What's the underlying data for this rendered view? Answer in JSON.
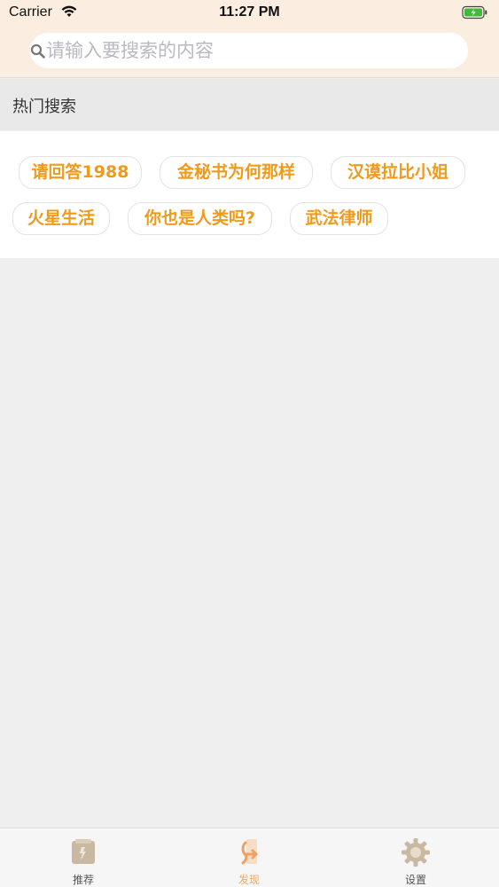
{
  "status_bar": {
    "carrier": "Carrier",
    "time": "11:27 PM"
  },
  "search": {
    "placeholder": "请输入要搜索的内容",
    "value": ""
  },
  "hot_search": {
    "title": "热门搜索",
    "tags": [
      "请回答1988",
      "金秘书为何那样",
      "汉谟拉比小姐",
      "火星生活",
      "你也是人类吗?",
      "武法律师"
    ]
  },
  "tabbar": {
    "items": [
      {
        "label": "推荐",
        "icon": "book-icon",
        "active": false
      },
      {
        "label": "发现",
        "icon": "discover-icon",
        "active": true
      },
      {
        "label": "设置",
        "icon": "gear-icon",
        "active": false
      }
    ]
  },
  "colors": {
    "header_bg": "#fbeee0",
    "tag_text": "#f09a1c",
    "tab_active": "#f0a860"
  }
}
